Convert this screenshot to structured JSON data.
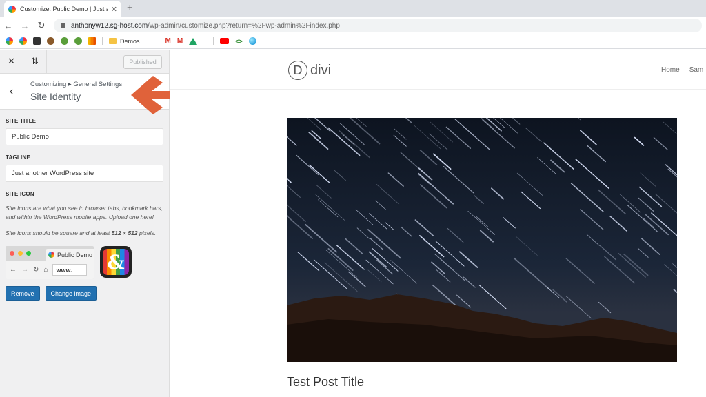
{
  "browser": {
    "tab_title": "Customize: Public Demo | Just an…",
    "url_host": "anthonyw12.sg-host.com",
    "url_path": "/wp-admin/customize.php?return=%2Fwp-admin%2Findex.php",
    "bookmark_folder": "Demos"
  },
  "customizer": {
    "published_label": "Published",
    "breadcrumb": "Customizing ▸ General Settings",
    "section_title": "Site Identity",
    "site_title_label": "SITE TITLE",
    "site_title_value": "Public Demo",
    "tagline_label": "TAGLINE",
    "tagline_value": "Just another WordPress site",
    "site_icon_label": "SITE ICON",
    "icon_desc_1": "Site Icons are what you see in browser tabs, bookmark bars, and within the WordPress mobile apps. Upload one here!",
    "icon_desc_2_pre": "Site Icons should be square and at least ",
    "icon_desc_2_bold": "512 × 512",
    "icon_desc_2_post": " pixels.",
    "preview_tab_text": "Public Demo",
    "preview_url_text": "www.",
    "app_icon_glyph": "&",
    "remove_label": "Remove",
    "change_label": "Change image",
    "accent_color": "#2271b1",
    "arrow_color": "#e0623a"
  },
  "site": {
    "logo_letter": "D",
    "logo_text": "divi",
    "menu": [
      "Home",
      "Sam"
    ],
    "post_title": "Test Post Title"
  }
}
